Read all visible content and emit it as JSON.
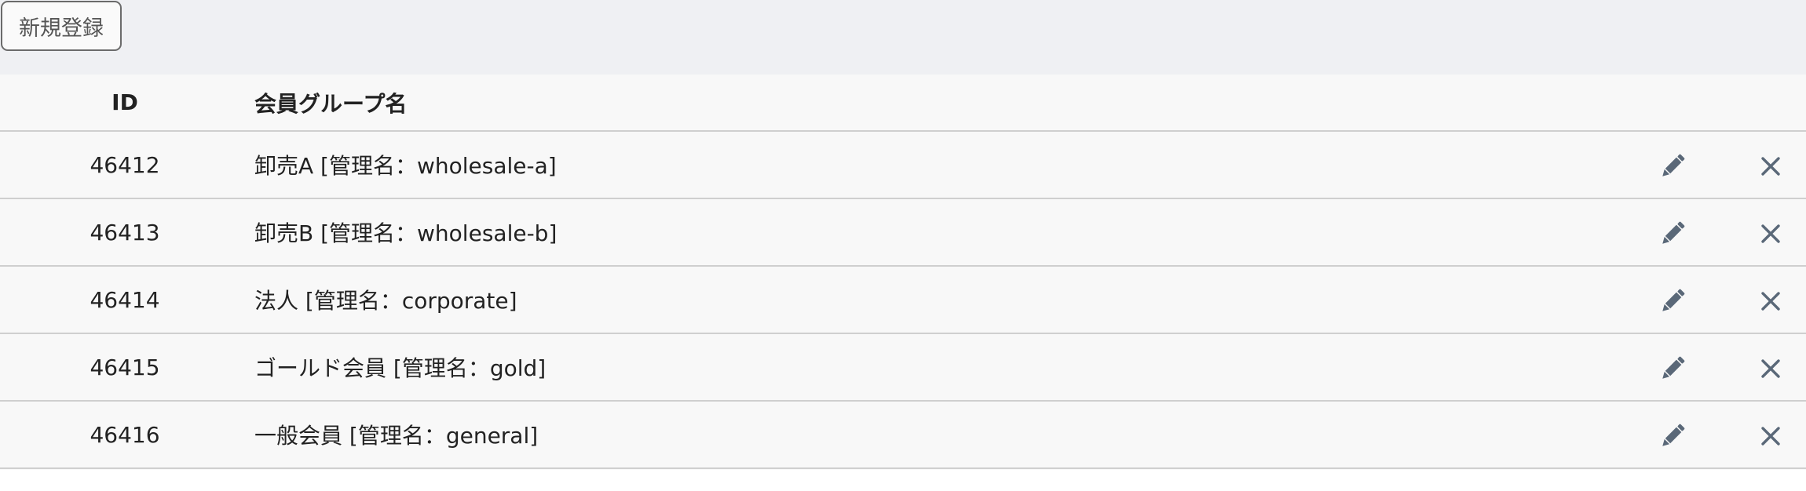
{
  "toolbar": {
    "new_label": "新規登録"
  },
  "table": {
    "columns": {
      "id": "ID",
      "name": "会員グループ名"
    },
    "rows": [
      {
        "id": "46412",
        "name": "卸売A [管理名：wholesale-a]"
      },
      {
        "id": "46413",
        "name": "卸売B [管理名：wholesale-b]"
      },
      {
        "id": "46414",
        "name": "法人 [管理名：corporate]"
      },
      {
        "id": "46415",
        "name": "ゴールド会員 [管理名：gold]"
      },
      {
        "id": "46416",
        "name": "一般会員 [管理名：general]"
      }
    ]
  },
  "icons": {
    "edit": "pencil-icon",
    "delete": "close-icon"
  },
  "colors": {
    "icon": "#5a6878",
    "header_bg": "#eff0f3",
    "table_bg": "#f8f8f8",
    "divider": "#cfcfcf"
  }
}
